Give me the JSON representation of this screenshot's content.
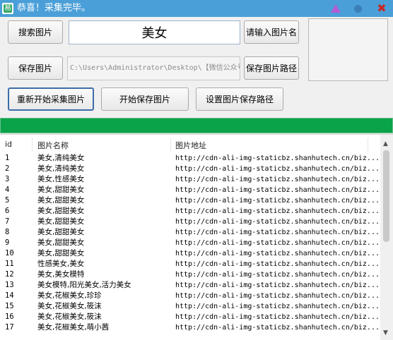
{
  "window": {
    "title": "恭喜！采集完毕。",
    "controls": [
      "triangle-icon",
      "dot-icon",
      "close-icon"
    ],
    "close_glyph": "✖"
  },
  "buttons": {
    "search": "搜索图片",
    "save": "保存图片",
    "restart": "重新开始采集图片",
    "start_save": "开始保存图片",
    "set_path": "设置图片保存路径",
    "enter_name": "请输入图片名",
    "save_path": "保存图片路径"
  },
  "inputs": {
    "keyword": "美女",
    "path": "C:\\Users\\Administrator\\Desktop\\【微信公众号"
  },
  "progress": {
    "percent": 100,
    "color": "#0aa34a"
  },
  "table": {
    "columns": [
      "id",
      "图片名称",
      "图片地址"
    ],
    "rows": [
      [
        "1",
        "美女,清纯美女",
        "http://cdn-ali-img-staticbz.shanhutech.cn/biz..."
      ],
      [
        "2",
        "美女,清纯美女",
        "http://cdn-ali-img-staticbz.shanhutech.cn/biz..."
      ],
      [
        "3",
        "美女,性感美女",
        "http://cdn-ali-img-staticbz.shanhutech.cn/biz..."
      ],
      [
        "4",
        "美女,甜甜美女",
        "http://cdn-ali-img-staticbz.shanhutech.cn/biz..."
      ],
      [
        "5",
        "美女,甜甜美女",
        "http://cdn-ali-img-staticbz.shanhutech.cn/biz..."
      ],
      [
        "6",
        "美女,甜甜美女",
        "http://cdn-ali-img-staticbz.shanhutech.cn/biz..."
      ],
      [
        "7",
        "美女,甜甜美女",
        "http://cdn-ali-img-staticbz.shanhutech.cn/biz..."
      ],
      [
        "8",
        "美女,甜甜美女",
        "http://cdn-ali-img-staticbz.shanhutech.cn/biz..."
      ],
      [
        "9",
        "美女,甜甜美女",
        "http://cdn-ali-img-staticbz.shanhutech.cn/biz..."
      ],
      [
        "10",
        "美女,甜甜美女",
        "http://cdn-ali-img-staticbz.shanhutech.cn/biz..."
      ],
      [
        "11",
        "性感美女,美女",
        "http://cdn-ali-img-staticbz.shanhutech.cn/biz..."
      ],
      [
        "12",
        "美女,美女模特",
        "http://cdn-ali-img-staticbz.shanhutech.cn/biz..."
      ],
      [
        "13",
        "美女模特,阳光美女,活力美女",
        "http://cdn-ali-img-staticbz.shanhutech.cn/biz..."
      ],
      [
        "14",
        "美女,花椒美女,珍珍",
        "http://cdn-ali-img-staticbz.shanhutech.cn/biz..."
      ],
      [
        "15",
        "美女,花椒美女,筱沫",
        "http://cdn-ali-img-staticbz.shanhutech.cn/biz..."
      ],
      [
        "16",
        "美女,花椒美女,筱沫",
        "http://cdn-ali-img-staticbz.shanhutech.cn/biz..."
      ],
      [
        "17",
        "美女,花椒美女,萌小茜",
        "http://cdn-ali-img-staticbz.shanhutech.cn/biz..."
      ]
    ]
  },
  "scrollbar": {
    "up_glyph": "▲",
    "down_glyph": "▼"
  }
}
